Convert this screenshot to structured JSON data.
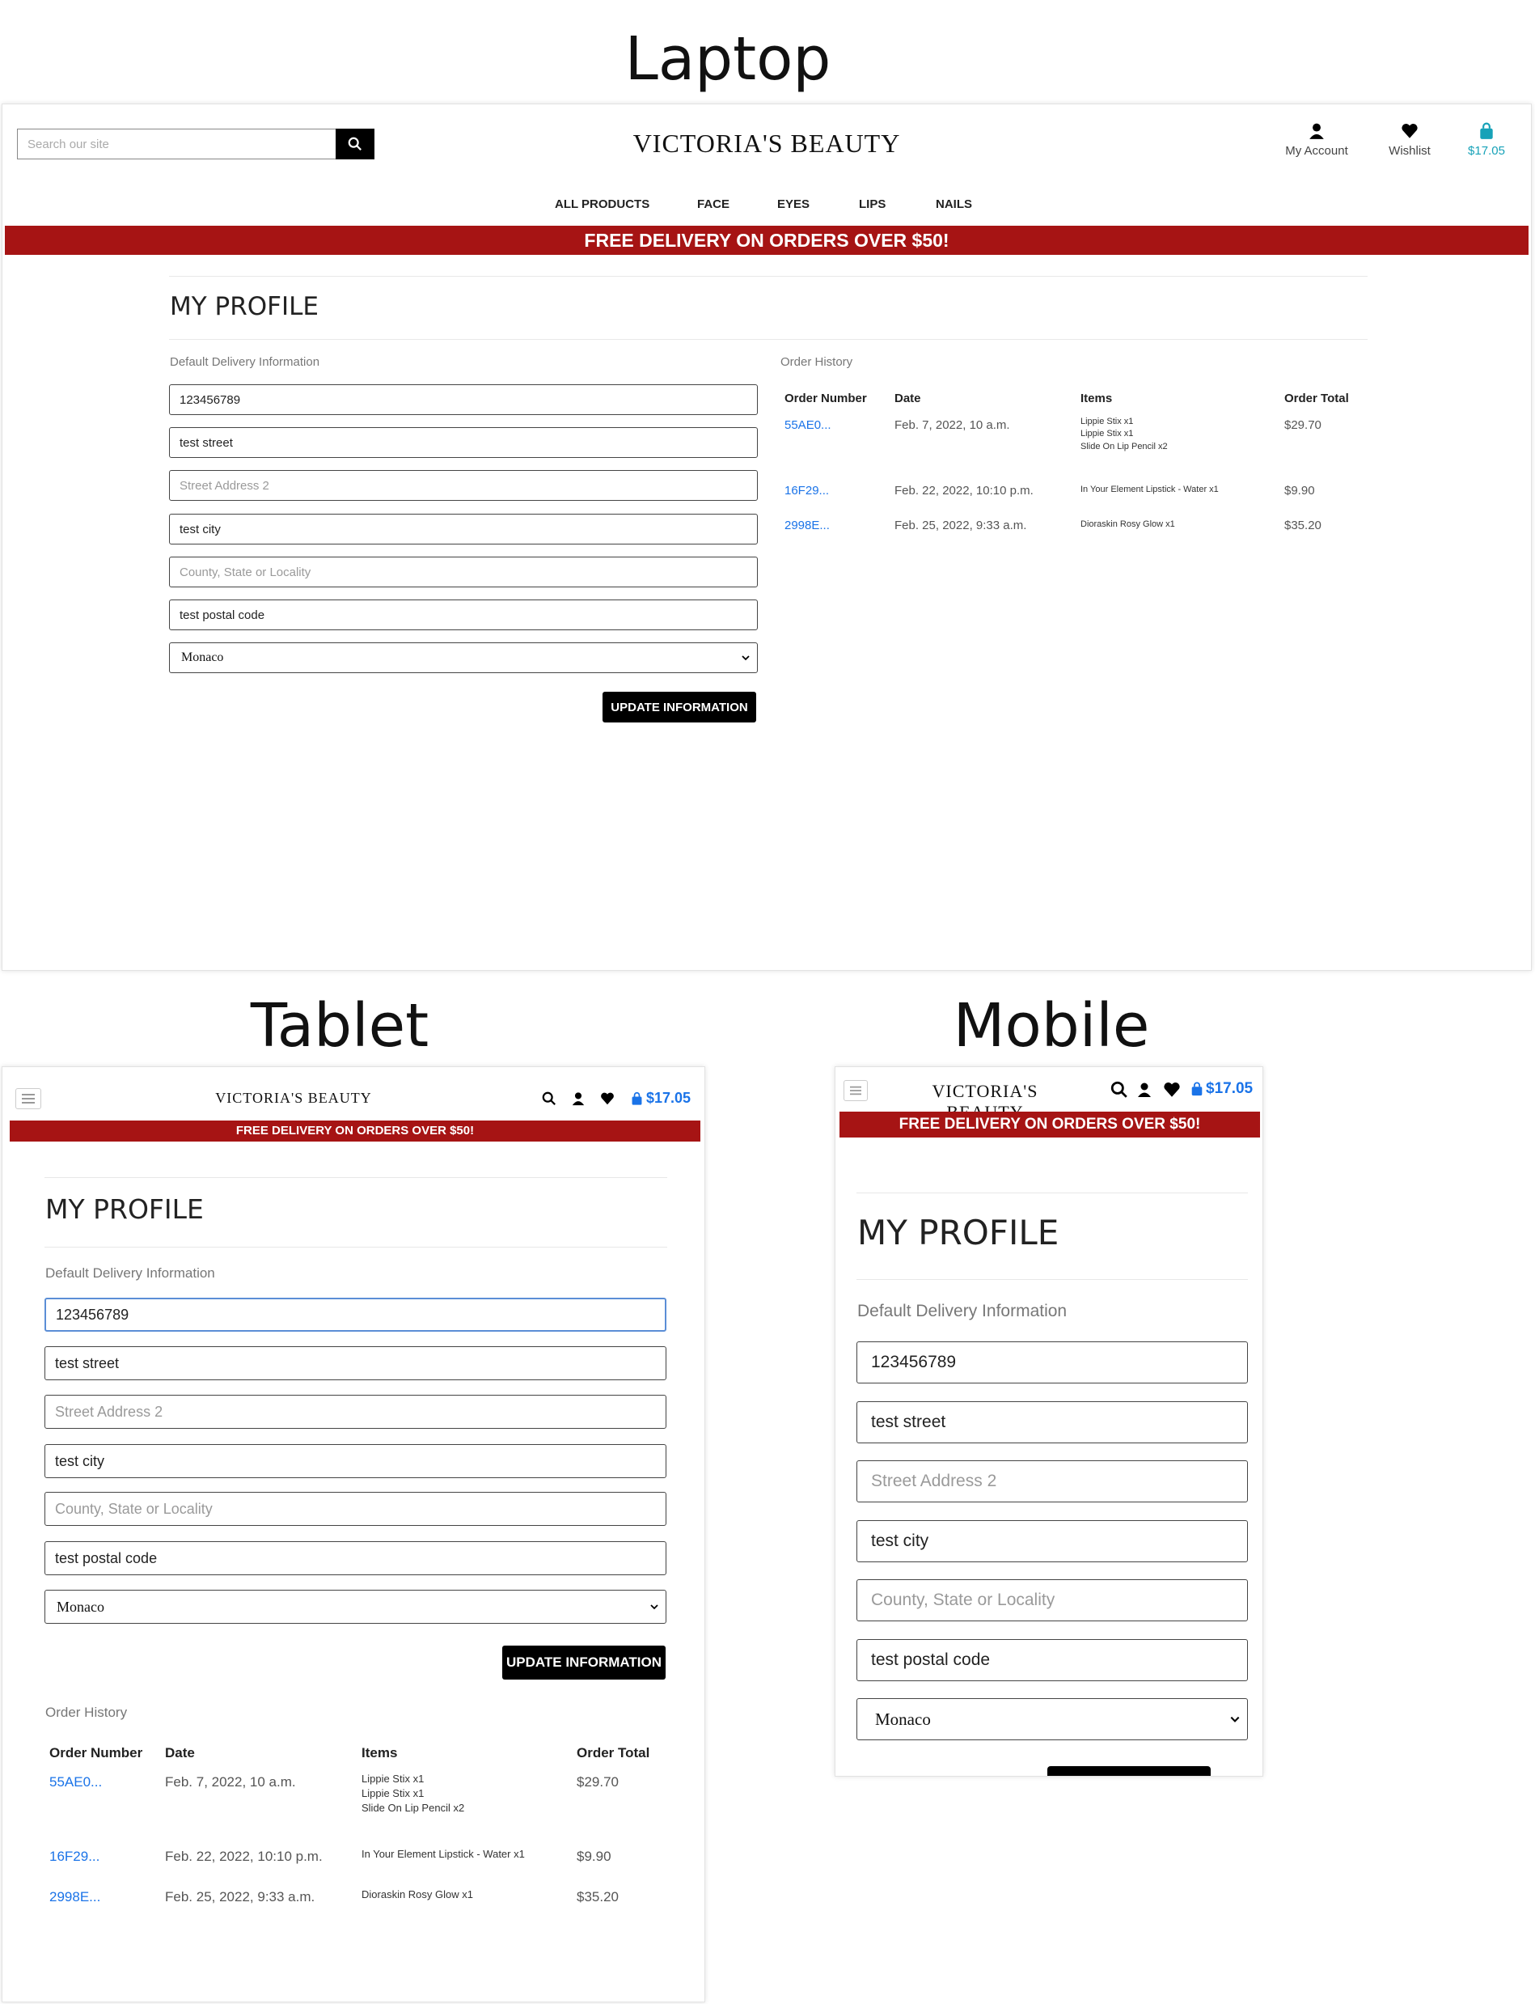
{
  "labels": {
    "laptop": "Laptop",
    "tablet": "Tablet",
    "mobile": "Mobile"
  },
  "brand": "VICTORIA'S BEAUTY",
  "search_placeholder": "Search our site",
  "header": {
    "my_account": "My Account",
    "wishlist": "Wishlist",
    "cart_total": "$17.05"
  },
  "nav": [
    "ALL PRODUCTS",
    "FACE",
    "EYES",
    "LIPS",
    "NAILS"
  ],
  "banner": "FREE DELIVERY ON ORDERS OVER $50!",
  "profile": {
    "title": "MY PROFILE",
    "delivery_heading": "Default Delivery Information",
    "fields": [
      {
        "value": "123456789",
        "placeholder": ""
      },
      {
        "value": "test street",
        "placeholder": ""
      },
      {
        "value": "",
        "placeholder": "Street Address 2"
      },
      {
        "value": "test city",
        "placeholder": ""
      },
      {
        "value": "",
        "placeholder": "County, State or Locality"
      },
      {
        "value": "test postal code",
        "placeholder": ""
      }
    ],
    "country": "Monaco",
    "update_button": "UPDATE INFORMATION"
  },
  "order_history": {
    "heading": "Order History",
    "columns": [
      "Order Number",
      "Date",
      "Items",
      "Order Total"
    ],
    "rows": [
      {
        "number": "55AE0...",
        "date": "Feb. 7, 2022, 10 a.m.",
        "items": [
          "Lippie Stix x1",
          "Lippie Stix x1",
          "Slide On Lip Pencil x2"
        ],
        "total": "$29.70"
      },
      {
        "number": "16F29...",
        "date": "Feb. 22, 2022, 10:10 p.m.",
        "items": [
          "In Your Element Lipstick - Water x1"
        ],
        "total": "$9.90"
      },
      {
        "number": "2998E...",
        "date": "Feb. 25, 2022, 9:33 a.m.",
        "items": [
          "Dioraskin Rosy Glow x1"
        ],
        "total": "$35.20"
      }
    ]
  },
  "colors": {
    "banner": "#a61414",
    "accent": "#1a73e8",
    "button": "#000000"
  }
}
